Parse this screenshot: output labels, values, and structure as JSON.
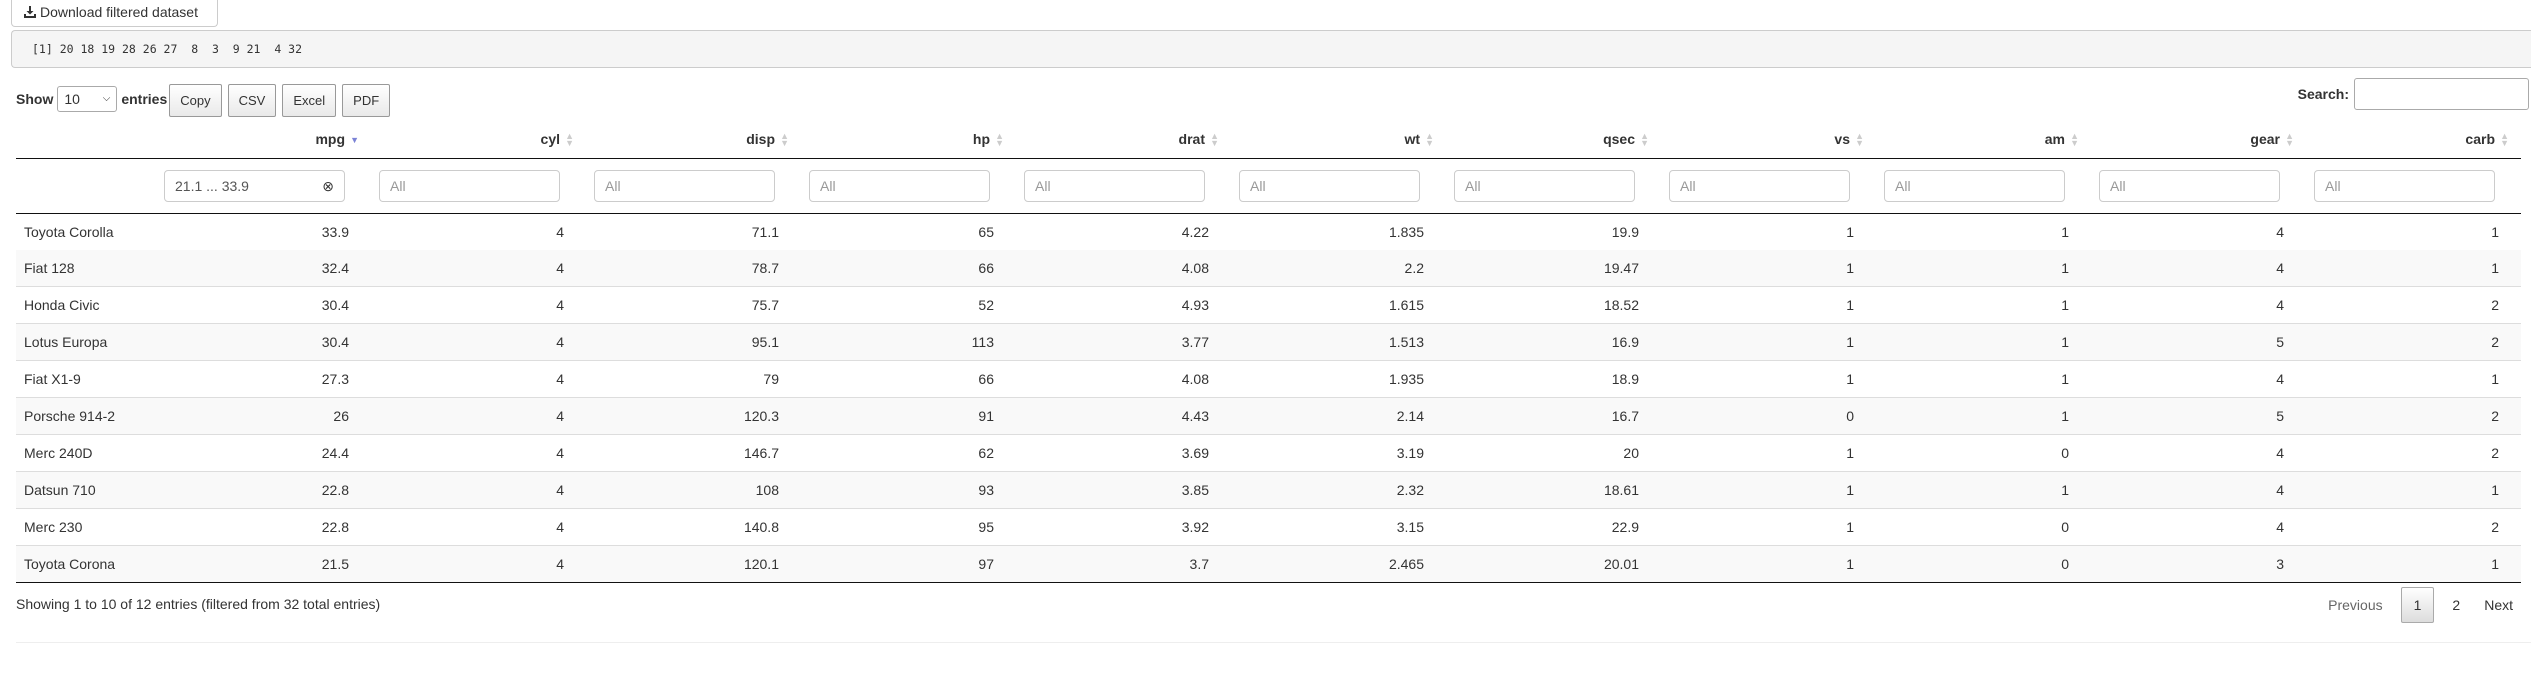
{
  "download_button": {
    "label": "Download filtered dataset",
    "icon": "download-icon"
  },
  "console_output": "[1] 20 18 19 28 26 27  8  3  9 21  4 32",
  "controls": {
    "show_label": "Show",
    "entries_value": "10",
    "entries_label": "entries",
    "buttons": [
      "Copy",
      "CSV",
      "Excel",
      "PDF"
    ],
    "search_label": "Search:",
    "search_value": ""
  },
  "table": {
    "columns": [
      "",
      "mpg",
      "cyl",
      "disp",
      "hp",
      "drat",
      "wt",
      "qsec",
      "vs",
      "am",
      "gear",
      "carb"
    ],
    "sorted_column": "mpg",
    "sort_direction": "descending",
    "sort_color": "#7b83d6",
    "filters": {
      "mpg": "21.1 ... 33.9",
      "placeholder": "All"
    },
    "rows": [
      [
        "Toyota Corolla",
        "33.9",
        "4",
        "71.1",
        "65",
        "4.22",
        "1.835",
        "19.9",
        "1",
        "1",
        "4",
        "1"
      ],
      [
        "Fiat 128",
        "32.4",
        "4",
        "78.7",
        "66",
        "4.08",
        "2.2",
        "19.47",
        "1",
        "1",
        "4",
        "1"
      ],
      [
        "Honda Civic",
        "30.4",
        "4",
        "75.7",
        "52",
        "4.93",
        "1.615",
        "18.52",
        "1",
        "1",
        "4",
        "2"
      ],
      [
        "Lotus Europa",
        "30.4",
        "4",
        "95.1",
        "113",
        "3.77",
        "1.513",
        "16.9",
        "1",
        "1",
        "5",
        "2"
      ],
      [
        "Fiat X1-9",
        "27.3",
        "4",
        "79",
        "66",
        "4.08",
        "1.935",
        "18.9",
        "1",
        "1",
        "4",
        "1"
      ],
      [
        "Porsche 914-2",
        "26",
        "4",
        "120.3",
        "91",
        "4.43",
        "2.14",
        "16.7",
        "0",
        "1",
        "5",
        "2"
      ],
      [
        "Merc 240D",
        "24.4",
        "4",
        "146.7",
        "62",
        "3.69",
        "3.19",
        "20",
        "1",
        "0",
        "4",
        "2"
      ],
      [
        "Datsun 710",
        "22.8",
        "4",
        "108",
        "93",
        "3.85",
        "2.32",
        "18.61",
        "1",
        "1",
        "4",
        "1"
      ],
      [
        "Merc 230",
        "22.8",
        "4",
        "140.8",
        "95",
        "3.92",
        "3.15",
        "22.9",
        "1",
        "0",
        "4",
        "2"
      ],
      [
        "Toyota Corona",
        "21.5",
        "4",
        "120.1",
        "97",
        "3.7",
        "2.465",
        "20.01",
        "1",
        "0",
        "3",
        "1"
      ]
    ]
  },
  "info": "Showing 1 to 10 of 12 entries (filtered from 32 total entries)",
  "pagination": {
    "previous": "Previous",
    "pages": [
      "1",
      "2"
    ],
    "current": "1",
    "next": "Next"
  }
}
